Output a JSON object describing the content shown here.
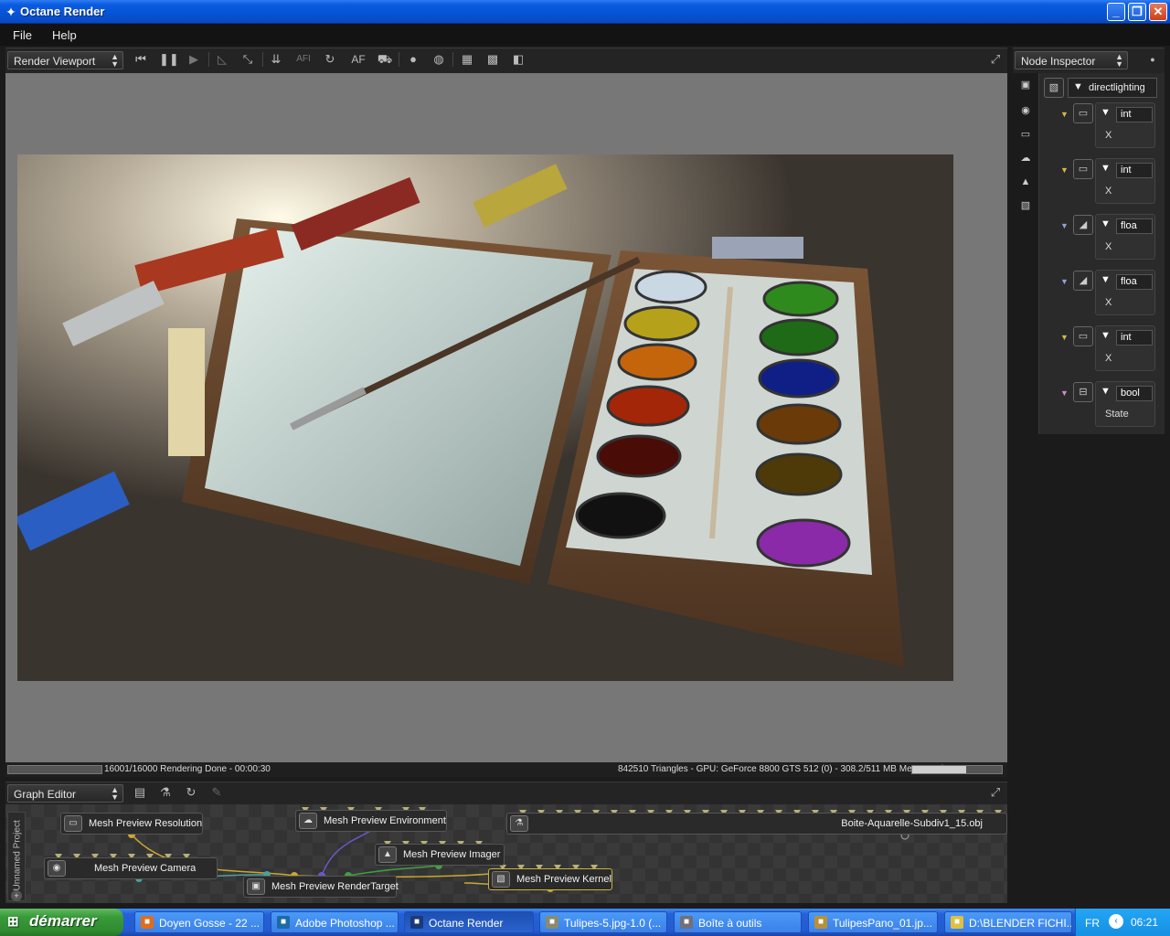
{
  "window": {
    "title": "Octane Render",
    "controls": [
      "_",
      "❐",
      "✕"
    ]
  },
  "menu": [
    "File",
    "Help"
  ],
  "viewport_toolbar": {
    "dropdown": "Render Viewport",
    "icons": [
      "rewind-icon",
      "pause-icon",
      "play-icon",
      "region-icon",
      "zoom-fit-icon",
      "import-icon",
      "afi-icon",
      "reload-icon",
      "af-label",
      "car-icon",
      "sphere-icon",
      "sphere2-icon",
      "grid-icon",
      "checker-icon",
      "checker2-icon",
      "fullscreen-icon"
    ],
    "af_label": "AF",
    "afi_label": "AFI"
  },
  "status": {
    "left": "16001/16000 Rendering Done - 00:00:30",
    "right": "842510 Triangles - GPU: GeForce 8800 GTS 512 (0) - 308.2/511 MB Mem Used",
    "render_progress": 1.0,
    "mem_progress": 0.6
  },
  "node_inspector": {
    "dropdown": "Node Inspector",
    "root": "directlighting",
    "nodes": [
      {
        "type": "int",
        "label": "X",
        "color": "#d4b84a"
      },
      {
        "type": "int",
        "label": "X",
        "color": "#d4b84a"
      },
      {
        "type": "floa",
        "label": "X",
        "color": "#8aa3d6"
      },
      {
        "type": "floa",
        "label": "X",
        "color": "#8aa3d6"
      },
      {
        "type": "int",
        "label": "X",
        "color": "#d4b84a"
      },
      {
        "type": "bool",
        "label": "State",
        "color": "#d08ac8"
      }
    ]
  },
  "graph_editor": {
    "dropdown": "Graph Editor",
    "project_tab": "Unnamed Project",
    "nodes": [
      {
        "label": "Mesh Preview Resolution"
      },
      {
        "label": "Mesh Preview Camera"
      },
      {
        "label": "Mesh Preview Environment"
      },
      {
        "label": "Mesh Preview Imager"
      },
      {
        "label": "Mesh Preview RenderTarget"
      },
      {
        "label": "Mesh Preview Kernel"
      },
      {
        "label": "Boite-Aquarelle-Subdiv1_15.obj"
      }
    ]
  },
  "taskbar": {
    "start": "démarrer",
    "tasks": [
      {
        "label": "Doyen Gosse - 22 ...",
        "active": false
      },
      {
        "label": "Adobe Photoshop ...",
        "active": false
      },
      {
        "label": "Octane Render",
        "active": true
      },
      {
        "label": "Tulipes-5.jpg-1.0 (...",
        "active": false
      },
      {
        "label": "Boîte à outils",
        "active": false
      },
      {
        "label": "TulipesPano_01.jp...",
        "active": false
      },
      {
        "label": "D:\\BLENDER FICHI...",
        "active": false
      }
    ],
    "lang": "FR",
    "clock": "06:21"
  },
  "colors": {
    "viewport_bg": "#777777",
    "kernel_node_border": "#c8b040",
    "accent_blue": "#0553d6"
  }
}
